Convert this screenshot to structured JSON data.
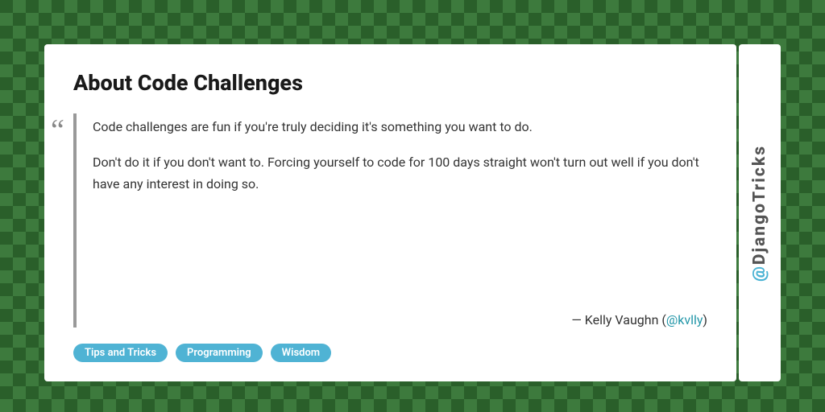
{
  "background": {
    "color": "#2d6a2d"
  },
  "card": {
    "title": "About Code Challenges",
    "quote": {
      "paragraph1": "Code challenges are fun if you're truly deciding it's something you want to do.",
      "paragraph2": "Don't do it if you don't want to. Forcing yourself to code for 100 days straight won't turn out well if you don't have any interest in doing so.",
      "attribution_prefix": "— Kelly Vaughn (",
      "attribution_handle": "@kvlly",
      "attribution_suffix": ")"
    },
    "tags": [
      "Tips and Tricks",
      "Programming",
      "Wisdom"
    ]
  },
  "sidebar": {
    "label_at": "@",
    "label_name": "DjangoTricks"
  }
}
